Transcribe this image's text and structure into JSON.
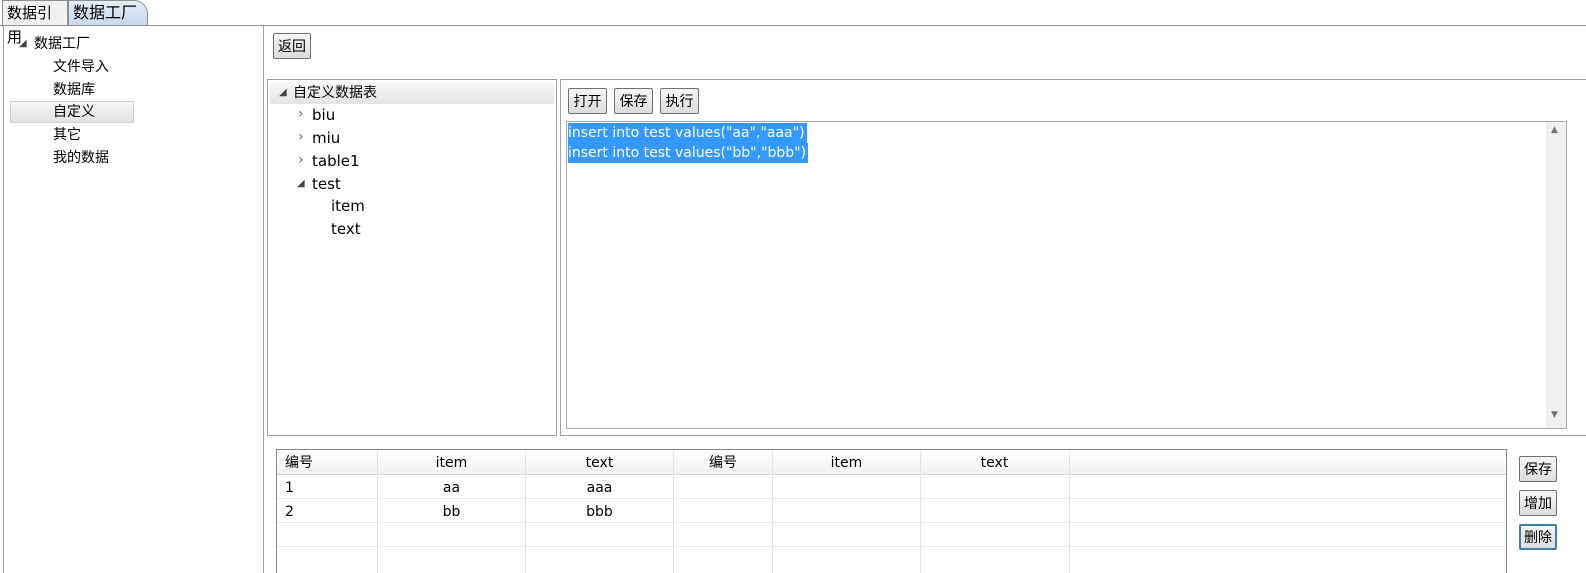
{
  "tabs": [
    {
      "label": "数据引用",
      "selected": false
    },
    {
      "label": "数据工厂",
      "selected": true
    }
  ],
  "nav_tree": {
    "root": "数据工厂",
    "items": [
      "文件导入",
      "数据库",
      "自定义",
      "其它",
      "我的数据"
    ],
    "selected": "自定义"
  },
  "back_button": "返回",
  "table_tree": {
    "root": "自定义数据表",
    "tables": [
      "biu",
      "miu",
      "table1",
      "test"
    ],
    "expanded_table": "test",
    "columns": [
      "item",
      "text"
    ]
  },
  "editor_toolbar": {
    "open": "打开",
    "save": "保存",
    "execute": "执行"
  },
  "sql_lines": [
    "insert into test values(\"aa\",\"aaa\")",
    "insert into test values(\"bb\",\"bbb\")"
  ],
  "grid": {
    "headers": [
      "编号",
      "item",
      "text",
      "编号",
      "item",
      "text"
    ],
    "rows": [
      [
        "1",
        "aa",
        "aaa",
        "",
        "",
        ""
      ],
      [
        "2",
        "bb",
        "bbb",
        "",
        "",
        ""
      ]
    ]
  },
  "grid_actions": {
    "save": "保存",
    "add": "增加",
    "delete": "删除"
  },
  "colors": {
    "selection": "#3399ff",
    "tab_active": "#c9d8ec",
    "active_border": "#3c7fb1"
  }
}
